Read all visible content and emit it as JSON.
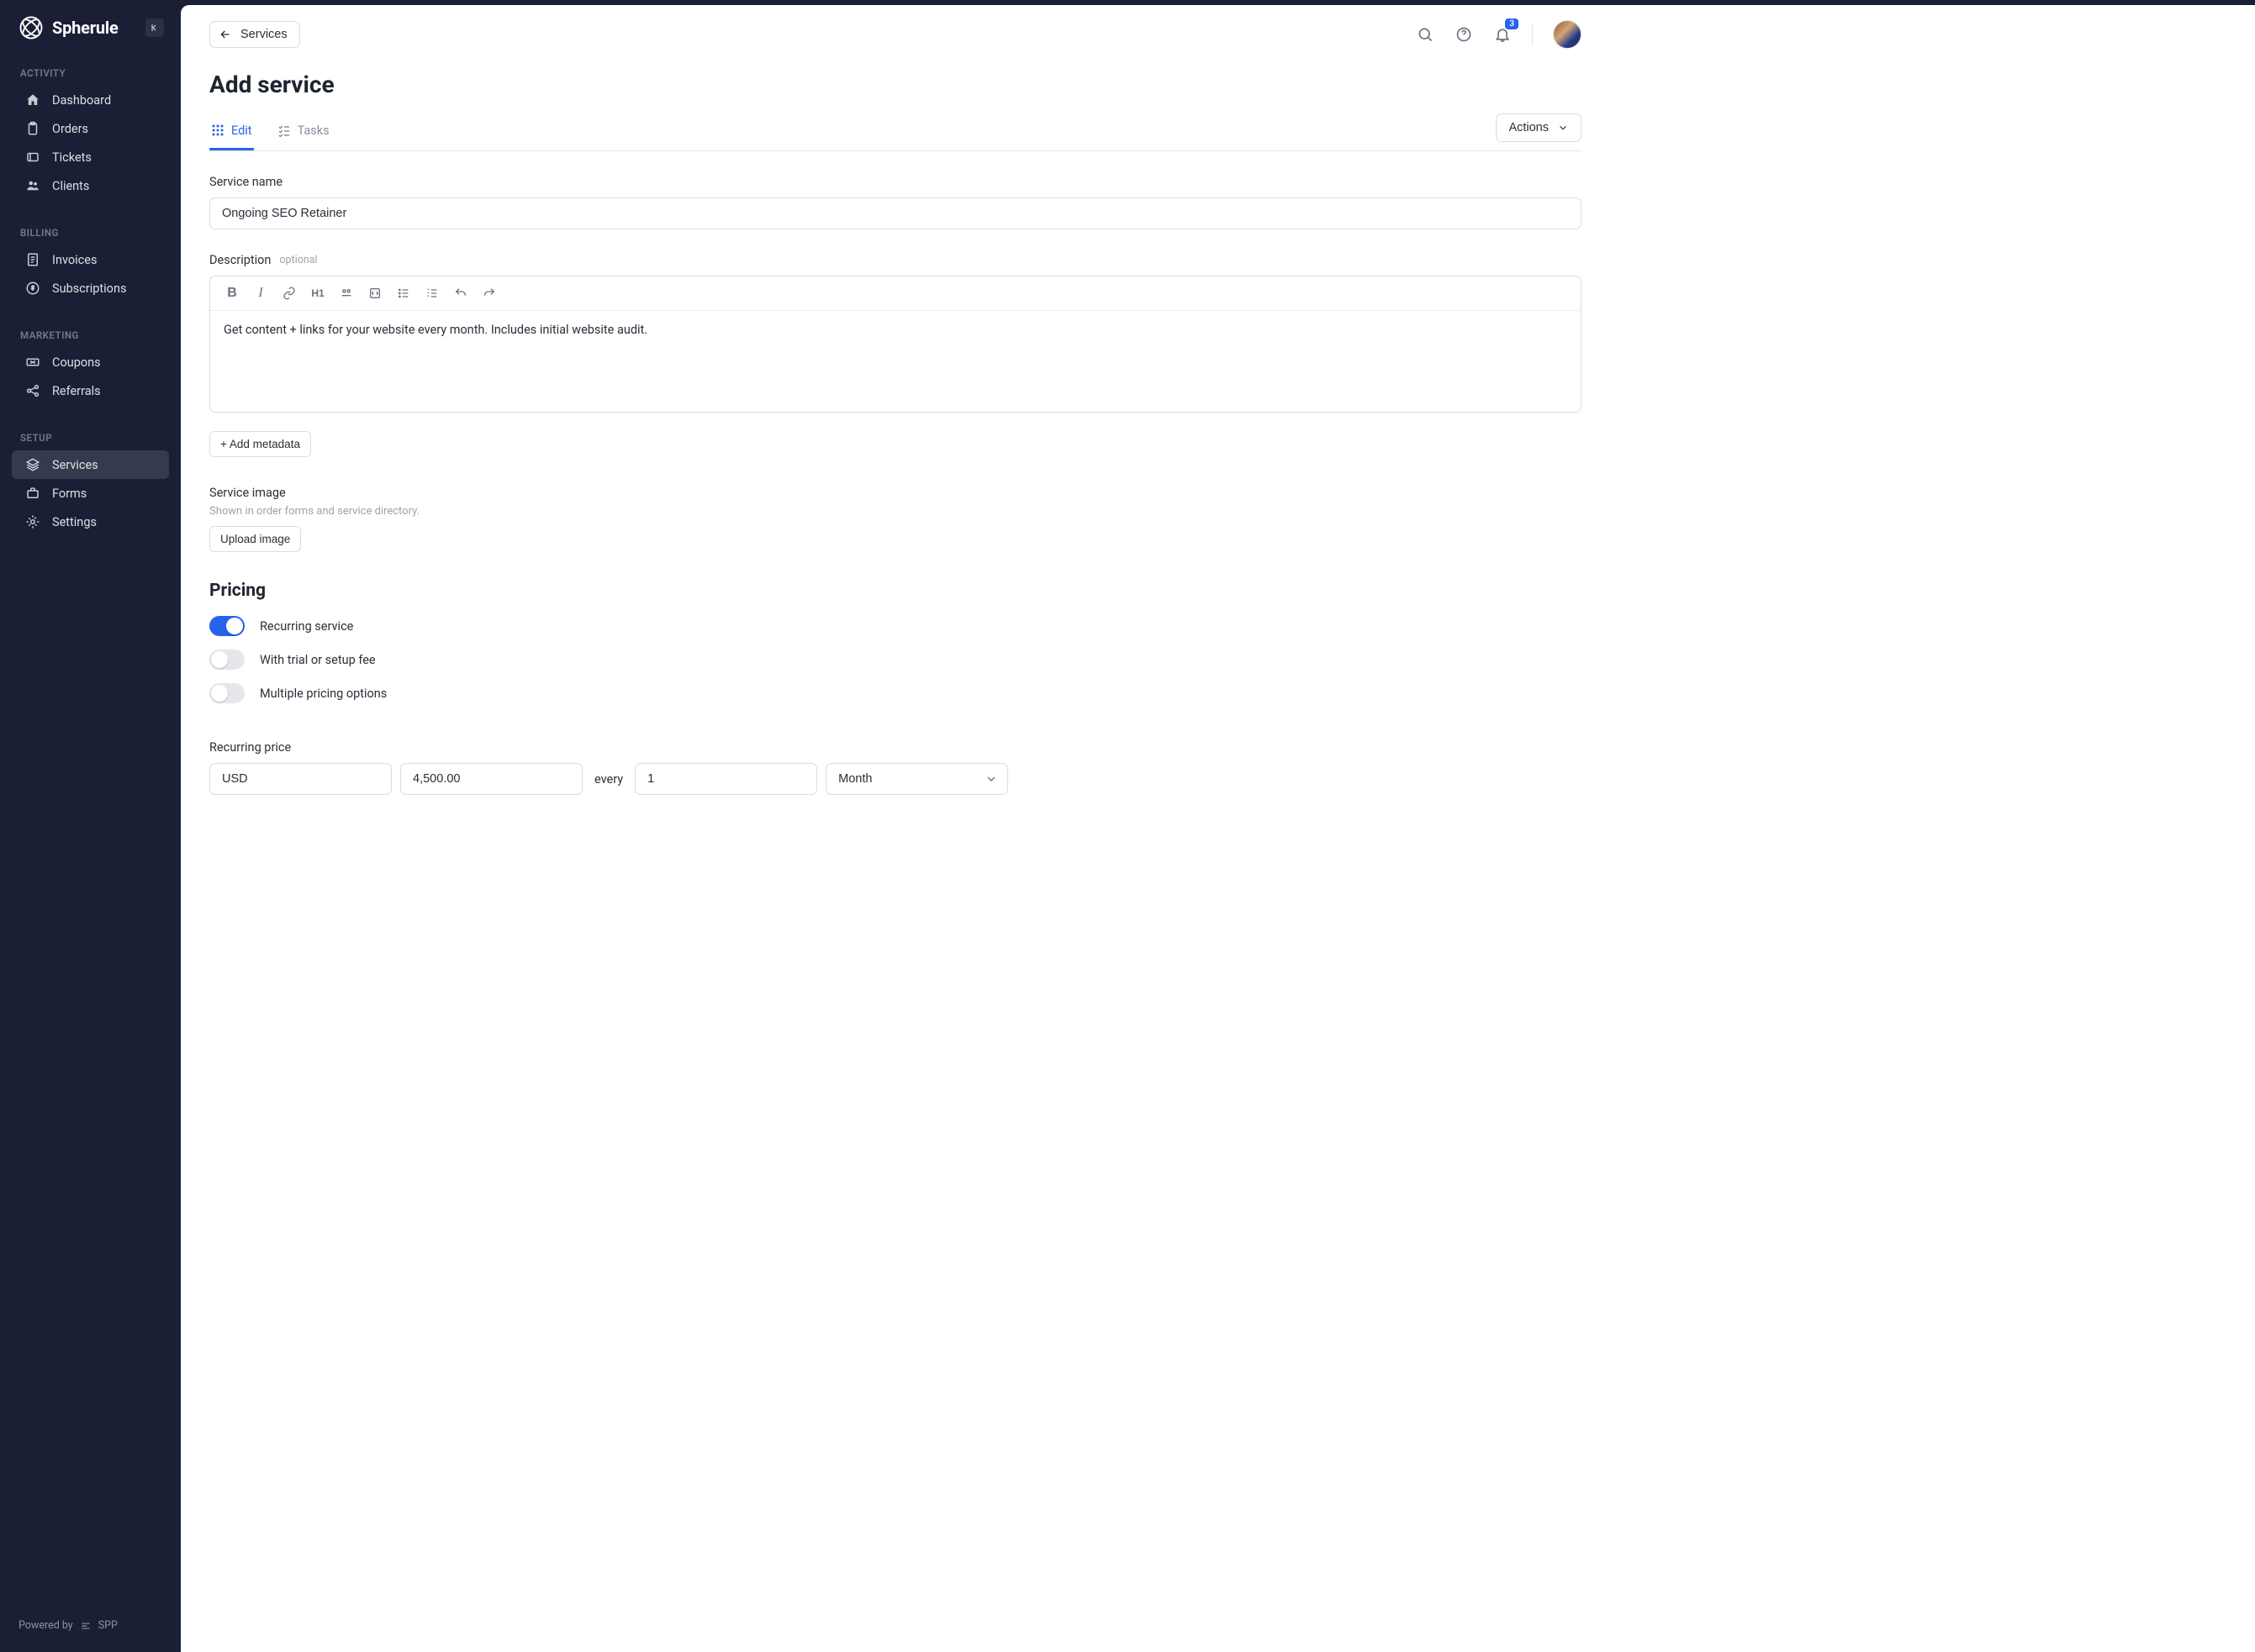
{
  "brand": "Spherule",
  "sidebar": {
    "sections": [
      {
        "title": "ACTIVITY",
        "items": [
          {
            "label": "Dashboard"
          },
          {
            "label": "Orders"
          },
          {
            "label": "Tickets"
          },
          {
            "label": "Clients"
          }
        ]
      },
      {
        "title": "BILLING",
        "items": [
          {
            "label": "Invoices"
          },
          {
            "label": "Subscriptions"
          }
        ]
      },
      {
        "title": "MARKETING",
        "items": [
          {
            "label": "Coupons"
          },
          {
            "label": "Referrals"
          }
        ]
      },
      {
        "title": "SETUP",
        "items": [
          {
            "label": "Services"
          },
          {
            "label": "Forms"
          },
          {
            "label": "Settings"
          }
        ]
      }
    ],
    "footer": {
      "powered": "Powered by",
      "spp": "SPP"
    }
  },
  "topbar": {
    "back_label": "Services",
    "badge": "3"
  },
  "page": {
    "title": "Add service"
  },
  "tabs": {
    "edit": "Edit",
    "tasks": "Tasks",
    "actions": "Actions"
  },
  "form": {
    "service_name_label": "Service name",
    "service_name_value": "Ongoing SEO Retainer",
    "description_label": "Description",
    "optional": "optional",
    "description_text": "Get content + links for your website every month. Includes initial website audit.",
    "add_metadata": "+ Add metadata",
    "service_image_label": "Service image",
    "service_image_hint": "Shown in order forms and service directory.",
    "upload_image": "Upload image"
  },
  "pricing": {
    "title": "Pricing",
    "recurring": "Recurring service",
    "trial": "With trial or setup fee",
    "multiple": "Multiple pricing options",
    "recurring_price_label": "Recurring price",
    "currency": "USD",
    "amount": "4,500.00",
    "every": "every",
    "interval_count": "1",
    "interval_unit": "Month"
  }
}
